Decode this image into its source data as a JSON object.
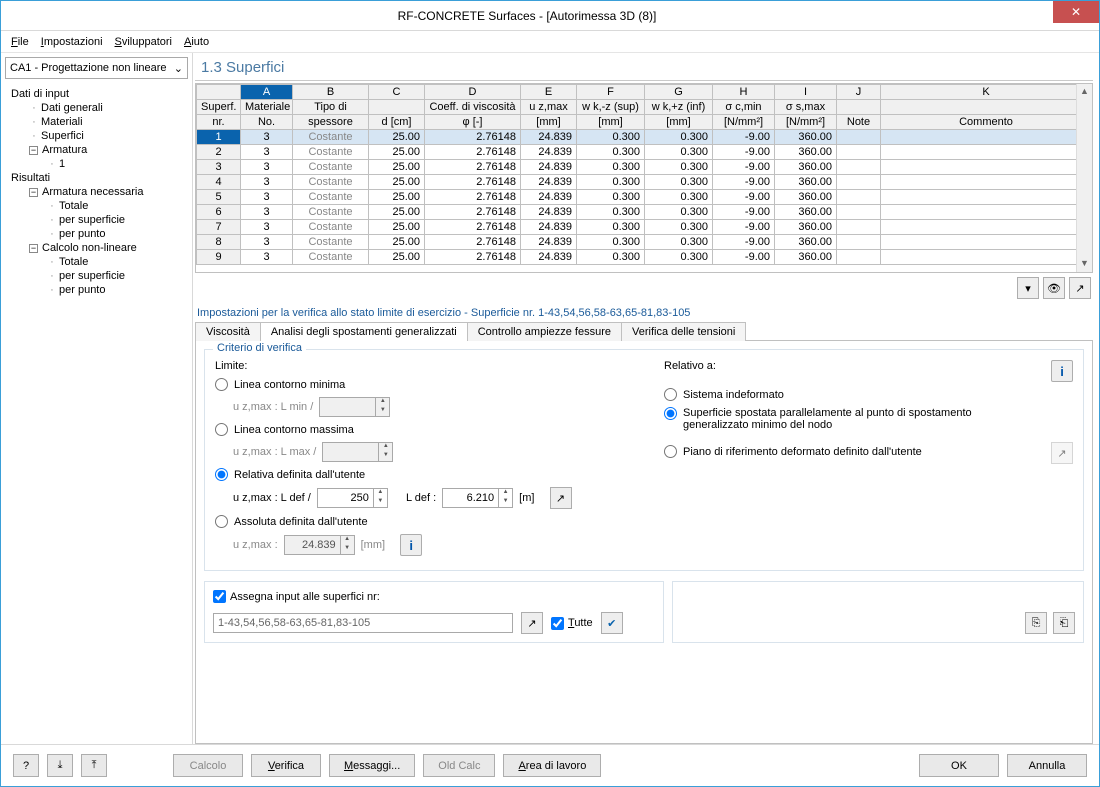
{
  "window": {
    "title": "RF-CONCRETE Surfaces - [Autorimessa 3D (8)]"
  },
  "menu": {
    "file": "File",
    "settings": "Impostazioni",
    "developers": "Sviluppatori",
    "help": "Aiuto"
  },
  "nav_select": "CA1 - Progettazione non lineare",
  "tree": {
    "input": "Dati di input",
    "general": "Dati generali",
    "materials": "Materiali",
    "surfaces": "Superfici",
    "reinf": "Armatura",
    "one": "1",
    "results": "Risultati",
    "req": "Armatura necessaria",
    "total": "Totale",
    "persurf": "per superficie",
    "perpoint": "per punto",
    "nonlin": "Calcolo non-lineare"
  },
  "heading": "1.3 Superfici",
  "columns": {
    "letters": [
      "A",
      "B",
      "C",
      "D",
      "E",
      "F",
      "G",
      "H",
      "I",
      "J",
      "K"
    ],
    "nr": "Superf.\nnr.",
    "matno": "Materiale\nNo.",
    "tipo": "Tipo di\nspessore",
    "d": "d [cm]",
    "phi": "Coeff. di viscosità\nφ [-]",
    "uz": "u z,max\n[mm]",
    "wksup": "w k,-z (sup)\n[mm]",
    "wkinf": "w k,+z (inf)\n[mm]",
    "scmin": "σ c,min\n[N/mm²]",
    "ssmax": "σ s,max\n[N/mm²]",
    "note": "Note",
    "comment": "Commento"
  },
  "rows": [
    {
      "n": "1",
      "m": "3",
      "t": "Costante",
      "d": "25.00",
      "p": "2.76148",
      "u": "24.839",
      "ws": "0.300",
      "wi": "0.300",
      "sc": "-9.00",
      "ss": "360.00"
    },
    {
      "n": "2",
      "m": "3",
      "t": "Costante",
      "d": "25.00",
      "p": "2.76148",
      "u": "24.839",
      "ws": "0.300",
      "wi": "0.300",
      "sc": "-9.00",
      "ss": "360.00"
    },
    {
      "n": "3",
      "m": "3",
      "t": "Costante",
      "d": "25.00",
      "p": "2.76148",
      "u": "24.839",
      "ws": "0.300",
      "wi": "0.300",
      "sc": "-9.00",
      "ss": "360.00"
    },
    {
      "n": "4",
      "m": "3",
      "t": "Costante",
      "d": "25.00",
      "p": "2.76148",
      "u": "24.839",
      "ws": "0.300",
      "wi": "0.300",
      "sc": "-9.00",
      "ss": "360.00"
    },
    {
      "n": "5",
      "m": "3",
      "t": "Costante",
      "d": "25.00",
      "p": "2.76148",
      "u": "24.839",
      "ws": "0.300",
      "wi": "0.300",
      "sc": "-9.00",
      "ss": "360.00"
    },
    {
      "n": "6",
      "m": "3",
      "t": "Costante",
      "d": "25.00",
      "p": "2.76148",
      "u": "24.839",
      "ws": "0.300",
      "wi": "0.300",
      "sc": "-9.00",
      "ss": "360.00"
    },
    {
      "n": "7",
      "m": "3",
      "t": "Costante",
      "d": "25.00",
      "p": "2.76148",
      "u": "24.839",
      "ws": "0.300",
      "wi": "0.300",
      "sc": "-9.00",
      "ss": "360.00"
    },
    {
      "n": "8",
      "m": "3",
      "t": "Costante",
      "d": "25.00",
      "p": "2.76148",
      "u": "24.839",
      "ws": "0.300",
      "wi": "0.300",
      "sc": "-9.00",
      "ss": "360.00"
    },
    {
      "n": "9",
      "m": "3",
      "t": "Costante",
      "d": "25.00",
      "p": "2.76148",
      "u": "24.839",
      "ws": "0.300",
      "wi": "0.300",
      "sc": "-9.00",
      "ss": "360.00"
    }
  ],
  "section_title": "Impostazioni per la verifica allo stato limite di esercizio - Superficie nr. 1-43,54,56,58-63,65-81,83-105",
  "tabs": {
    "visc": "Viscosità",
    "disp": "Analisi degli spostamenti generalizzati",
    "crack": "Controllo ampiezze fessure",
    "stress": "Verifica delle tensioni"
  },
  "criterion": {
    "legend": "Criterio di verifica",
    "limit_label": "Limite:",
    "rel_label": "Relativo a:",
    "opt_min": "Linea contorno minima",
    "min_sub": "u z,max :   L min /",
    "opt_max": "Linea contorno massima",
    "max_sub": "u z,max :   L max /",
    "opt_userrel": "Relativa definita dall'utente",
    "userrel_l": "u z,max :   L def /",
    "userrel_val": "250",
    "ldef_label": "L def :",
    "ldef_val": "6.210",
    "ldef_unit": "[m]",
    "opt_userabs": "Assoluta definita dall'utente",
    "abs_l": "u z,max :",
    "abs_val": "24.839",
    "abs_unit": "[mm]",
    "rel_opt1": "Sistema indeformato",
    "rel_opt2": "Superficie spostata parallelamente al punto di spostamento generalizzato minimo del nodo",
    "rel_opt3": "Piano di riferimento deformato definito dall'utente"
  },
  "assign": {
    "chk": "Assegna input alle superfici nr:",
    "value": "1-43,54,56,58-63,65-81,83-105",
    "all": "Tutte"
  },
  "buttons": {
    "calc": "Calcolo",
    "verify": "Verifica",
    "msgs": "Messaggi...",
    "old": "Old Calc",
    "area": "Area di lavoro",
    "ok": "OK",
    "cancel": "Annulla"
  }
}
